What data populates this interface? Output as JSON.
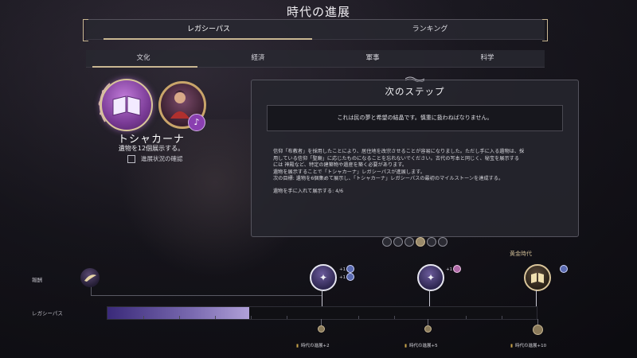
{
  "title": "時代の進展",
  "main_tabs": [
    {
      "label": "レガシーパス",
      "active": true
    },
    {
      "label": "ランキング",
      "active": false
    }
  ],
  "category_tabs": [
    {
      "label": "文化",
      "active": true
    },
    {
      "label": "経済",
      "active": false
    },
    {
      "label": "軍事",
      "active": false
    },
    {
      "label": "科学",
      "active": false
    }
  ],
  "civ": {
    "name": "トシャカーナ",
    "relic_text": "遺物を12個展示する。",
    "checkbox_label": "進展状況の確認",
    "checkbox_checked": false
  },
  "panel": {
    "title": "次のステップ",
    "quote": "これは民の夢と希望の結晶です。慎重に扱わねばなりません。",
    "desc_lines": [
      "信仰「布教者」を採用したことにより、居住地を改宗させることが容易になりました。ただし手に入る遺物は、採",
      "用している信仰「聖廟」に応じたものになることを忘れないでください。古代の写本と同じく、秘宝を展示する",
      "には 神殿など、特定の建築物や遺産を築く必要があります。",
      "遺物を展示することで「トシャカーナ」レガシーパスが進展します。",
      "次の目標: 遺物を6個集めて展示し、「トシャカーナ」レガシーパスの最初のマイルストーンを達成する。"
    ],
    "progress_text": "遺物を手に入れて展示する: 4/6"
  },
  "pager": {
    "count": 6,
    "active_index": 3
  },
  "track": {
    "reward_row_label": "報酬",
    "legacy_row_label": "レガシーパス",
    "golden_age_label": "黄金時代",
    "legacy_progress": 0.33,
    "milestone_a_bonus": [
      "+1",
      "+1"
    ],
    "milestone_b_bonus": [
      "+1"
    ],
    "rewards": [
      "時代の進展+2",
      "時代の進展+5",
      "時代の進展+10"
    ]
  },
  "colors": {
    "accent_gold": "#c9b792",
    "legacy_purple": "#7a6ab0",
    "panel_bg": "#26262e"
  },
  "icons": {
    "emblem": "book-laurel-icon",
    "portrait": "leader-portrait",
    "music": "music-note-icon",
    "milestone_a": "mind-puzzle-icon",
    "milestone_b": "mind-puzzle-icon",
    "milestone_c": "golden-book-icon",
    "start": "feather-icon"
  }
}
